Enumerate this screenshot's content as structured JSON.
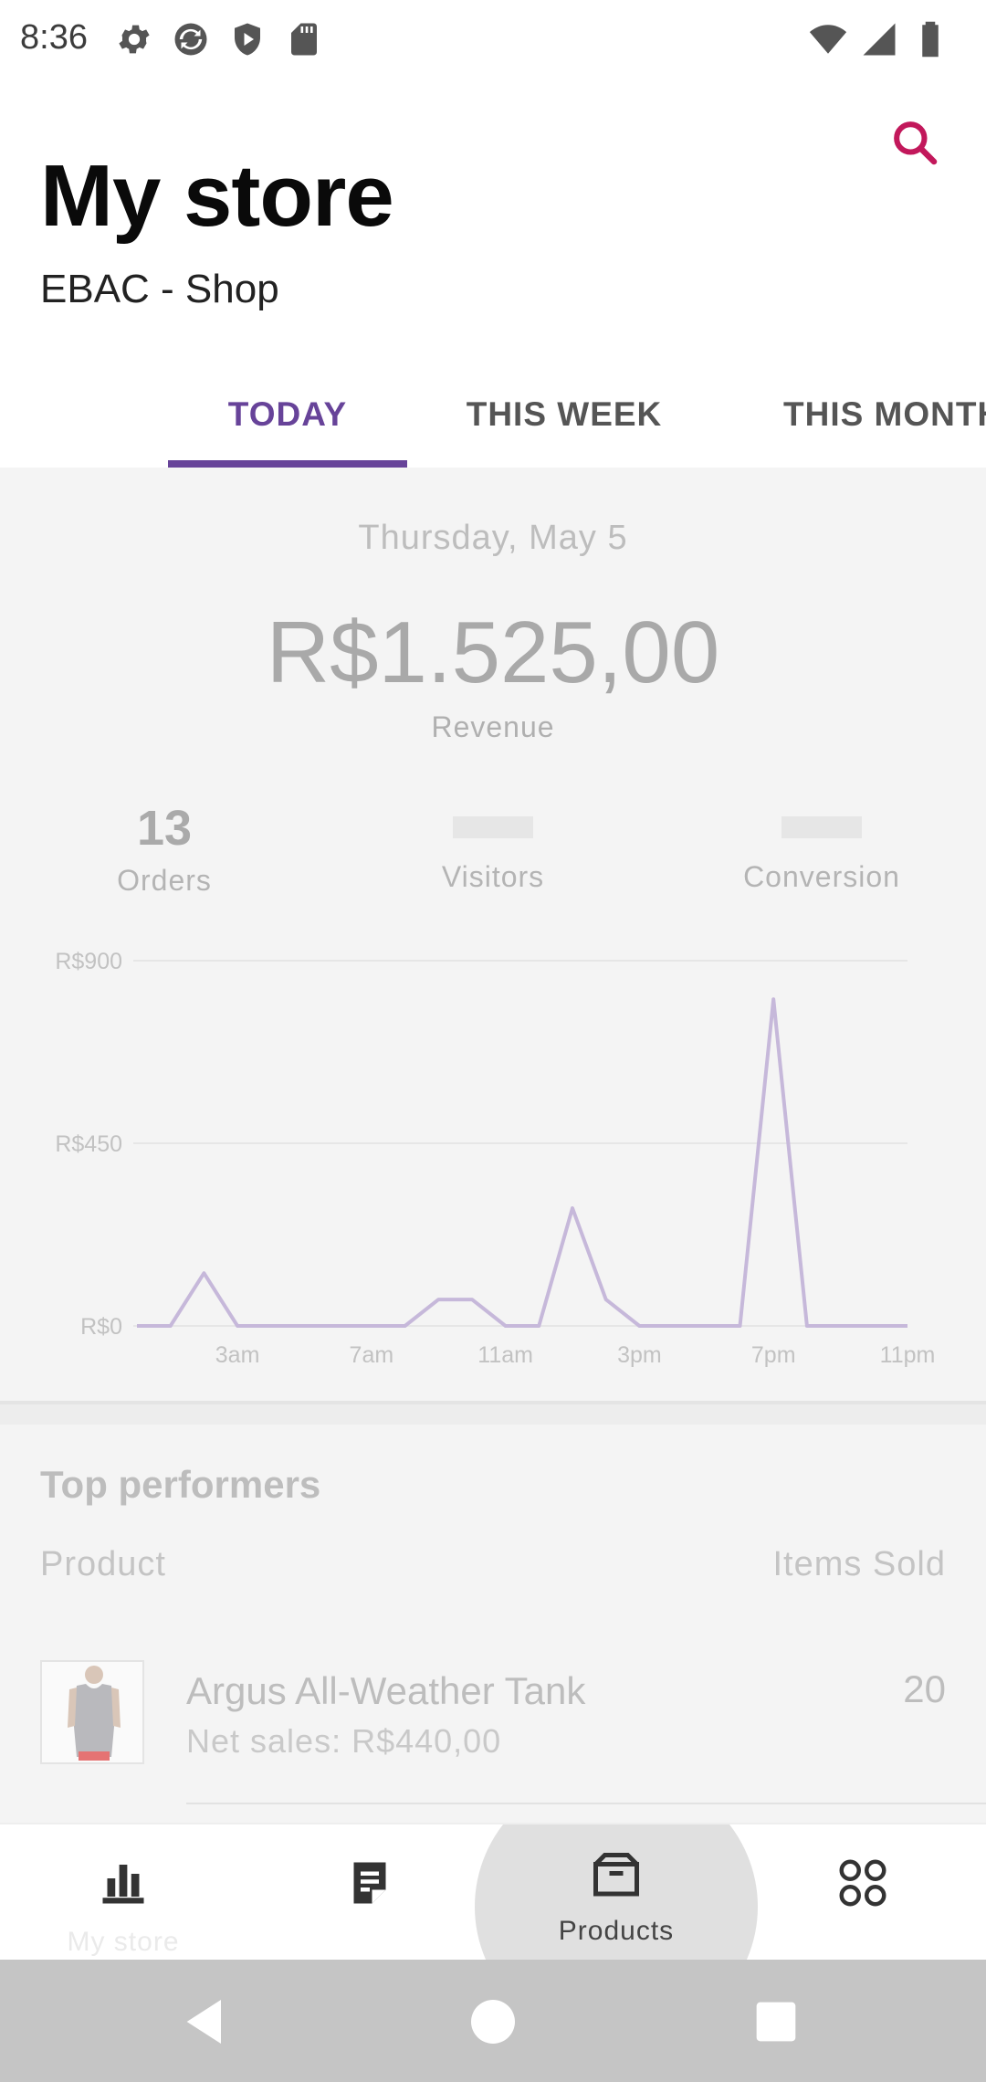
{
  "status_bar": {
    "time": "8:36",
    "left_icons": [
      "settings-icon",
      "sync-icon",
      "shield-icon",
      "sd-card-icon"
    ],
    "right_icons": [
      "wifi-icon",
      "cell-signal-icon",
      "battery-icon"
    ]
  },
  "header": {
    "title": "My store",
    "store_name": "EBAC - Shop",
    "search_icon": "search-icon",
    "accent_color": "#c2185b"
  },
  "tabs": {
    "items": [
      {
        "label": "TODAY",
        "active": true
      },
      {
        "label": "THIS WEEK",
        "active": false
      },
      {
        "label": "THIS MONTH",
        "active": false
      }
    ],
    "active_color": "#674399"
  },
  "stats": {
    "date": "Thursday, May 5",
    "revenue": "R$1.525,00",
    "revenue_label": "Revenue",
    "orders_value": "13",
    "orders_label": "Orders",
    "visitors_label": "Visitors",
    "conversion_label": "Conversion"
  },
  "chart_data": {
    "type": "line",
    "title": "",
    "xlabel": "",
    "ylabel": "",
    "y_ticks": [
      "R$0",
      "R$450",
      "R$900"
    ],
    "x_ticks": [
      "3am",
      "7am",
      "11am",
      "3pm",
      "7pm",
      "11pm"
    ],
    "ylim": [
      0,
      900
    ],
    "grid": true,
    "line_color": "#c6b8da",
    "series": [
      {
        "values": [
          0,
          0,
          130,
          0,
          0,
          0,
          0,
          0,
          0,
          65,
          65,
          0,
          0,
          290,
          65,
          0,
          0,
          0,
          0,
          805,
          0,
          0,
          0,
          0
        ]
      }
    ]
  },
  "top_performers": {
    "title": "Top performers",
    "col_product": "Product",
    "col_items_sold": "Items Sold",
    "rows": [
      {
        "name": "Argus All-Weather Tank",
        "net_sales": "Net sales: R$440,00",
        "items_sold": "20"
      }
    ]
  },
  "bottom_nav": {
    "items": [
      {
        "label": "My store",
        "icon": "bar-chart-icon"
      },
      {
        "label": "Orders",
        "icon": "orders-icon"
      },
      {
        "label": "Products",
        "icon": "product-box-icon"
      },
      {
        "label": "More",
        "icon": "apps-grid-icon"
      }
    ]
  },
  "system_nav": {
    "icons": [
      "back-icon",
      "home-icon",
      "recents-icon"
    ]
  }
}
